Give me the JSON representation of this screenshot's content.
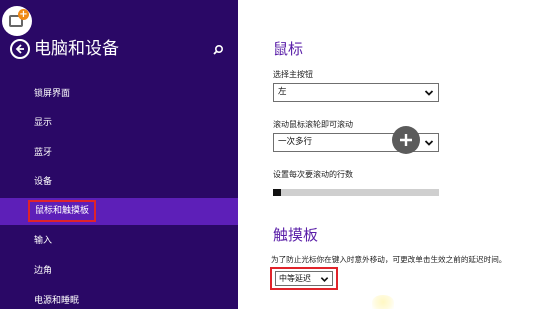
{
  "sidebar": {
    "title": "电脑和设备",
    "items": [
      {
        "label": "锁屏界面"
      },
      {
        "label": "显示"
      },
      {
        "label": "蓝牙"
      },
      {
        "label": "设备"
      },
      {
        "label": "鼠标和触摸板",
        "selected": true
      },
      {
        "label": "输入"
      },
      {
        "label": "边角"
      },
      {
        "label": "电源和睡眠"
      }
    ]
  },
  "mouse": {
    "title": "鼠标",
    "primary_button_label": "选择主按钮",
    "primary_button_value": "左",
    "wheel_label": "滚动鼠标滚轮即可滚动",
    "wheel_value": "一次多行",
    "lines_label": "设置每次要滚动的行数",
    "lines_level": 0.05
  },
  "touchpad": {
    "title": "触摸板",
    "delay_label": "为了防止光标你在键入时意外移动，可更改单击生效之前的延迟时间。",
    "delay_value": "中等延迟"
  },
  "colors": {
    "sidebar_bg": "#2a0866",
    "selected_bg": "#5d1fb8",
    "highlight_red": "#e0232a",
    "accent_purple": "#5a1fa8"
  }
}
